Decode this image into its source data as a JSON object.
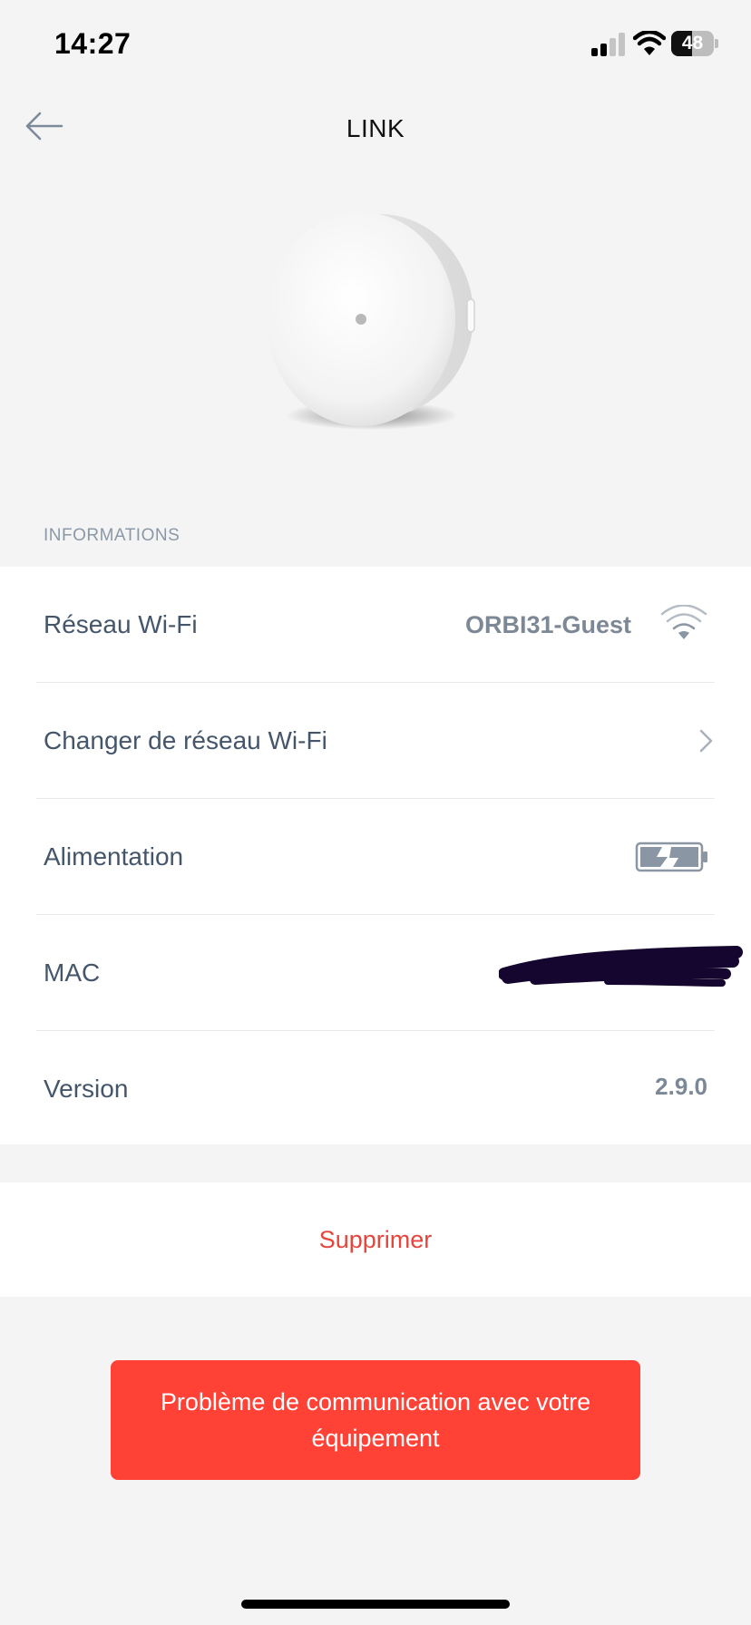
{
  "status_bar": {
    "time": "14:27",
    "battery_percent": "48",
    "battery_level": 0.48,
    "signal_bars_active": 2,
    "signal_bars_total": 4,
    "icons": [
      "signal-icon",
      "wifi-icon",
      "battery-icon"
    ]
  },
  "nav": {
    "title": "LINK",
    "back_icon": "arrow-left-icon"
  },
  "device": {
    "image": "round-white-device"
  },
  "informations": {
    "header": "INFORMATIONS",
    "rows": [
      {
        "label": "Réseau Wi-Fi",
        "value": "ORBI31-Guest",
        "icon": "wifi-strength-icon"
      },
      {
        "label": "Changer de réseau Wi-Fi",
        "icon": "chevron-right-icon"
      },
      {
        "label": "Alimentation",
        "icon": "battery-charging-icon"
      },
      {
        "label": "MAC",
        "value_state": "redacted"
      },
      {
        "label": "Version",
        "value": "2.9.0"
      }
    ]
  },
  "actions": {
    "delete_label": "Supprimer"
  },
  "alert": {
    "message": "Problème de communication avec votre équipement"
  },
  "colors": {
    "background": "#f4f4f4",
    "card": "#ffffff",
    "label_text": "#45566b",
    "value_text": "#7d8896",
    "danger_text": "#e5453c",
    "alert_background": "#ff4136"
  }
}
